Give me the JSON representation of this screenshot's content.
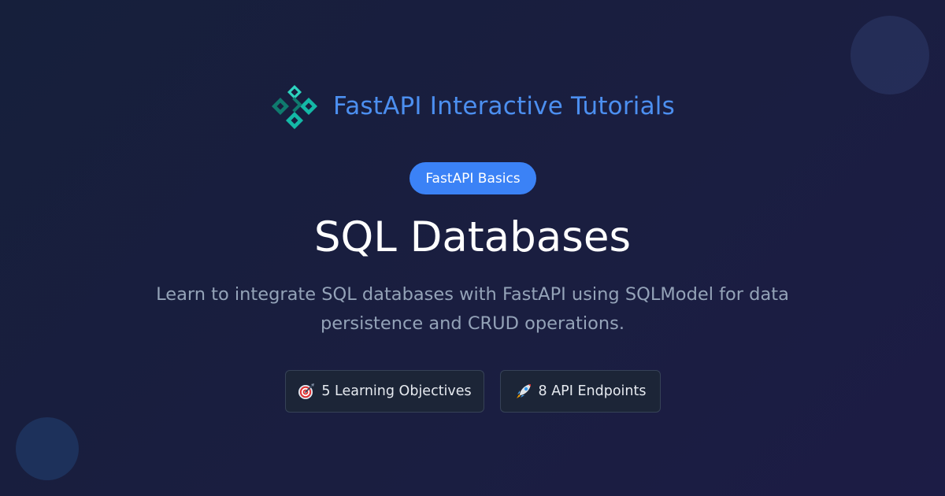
{
  "brand": {
    "logo_icon": "fastapi-diamond-logo-icon",
    "name": "FastAPI Interactive Tutorials",
    "color": "#4c8ff0",
    "logo_colors": [
      "#0f7a6e",
      "#14b8a6",
      "#2dd4bf"
    ]
  },
  "category": {
    "label": "FastAPI Basics",
    "color": "#3b82f6"
  },
  "title": "SQL Databases",
  "description": "Learn to integrate SQL databases with FastAPI using SQLModel for data persistence and CRUD operations.",
  "stats": [
    {
      "icon": "target-icon",
      "label": "5 Learning Objectives"
    },
    {
      "icon": "rocket-icon",
      "label": "8 API Endpoints"
    }
  ],
  "colors": {
    "background_start": "#161f3b",
    "background_end": "#1c1c45",
    "description": "#94a3b8",
    "stat_background": "#1c2537",
    "stat_border": "#364257"
  }
}
